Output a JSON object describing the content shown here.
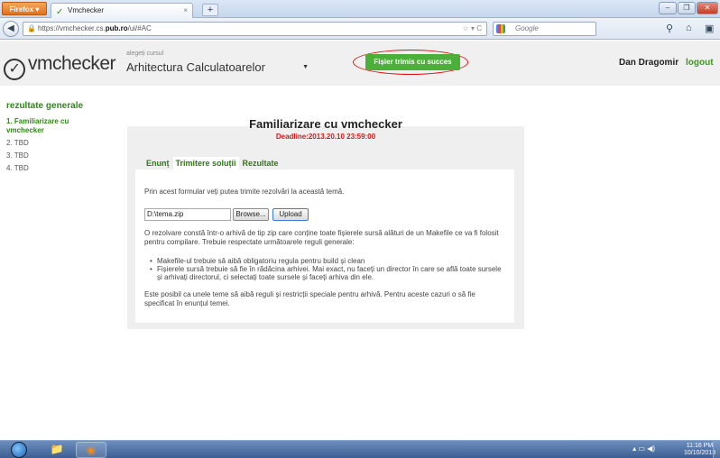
{
  "browser": {
    "menu_label": "Firefox",
    "tab_title": "Vmchecker",
    "url_prefix": "https://vmchecker.cs.",
    "url_domain": "pub.ro",
    "url_suffix": "/ui/#AC",
    "search_placeholder": "Google"
  },
  "header": {
    "logo_text": "vmchecker",
    "course_label": "alegeți cursul",
    "course_selected": "Arhitectura Calculatoarelor",
    "toast": "Fișier trimis cu succes",
    "user_name": "Dan Dragomir",
    "logout": "logout"
  },
  "sidebar": {
    "title": "rezultate generale",
    "items": [
      {
        "label": "1. Familiarizare cu vmchecker"
      },
      {
        "label": "2. TBD"
      },
      {
        "label": "3. TBD"
      },
      {
        "label": "4. TBD"
      }
    ]
  },
  "assignment": {
    "title": "Familiarizare cu vmchecker",
    "deadline": "Deadline:2013.20.10 23:59:00",
    "tabs": [
      "Enunț",
      "Trimitere soluții",
      "Rezultate"
    ],
    "intro": "Prin acest formular veți putea trimite rezolvări la această temă.",
    "file_value": "D:\\tema.zip",
    "browse_label": "Browse...",
    "upload_label": "Upload",
    "description": "O rezolvare constă într-o arhivă de tip zip care conține toate fișierele sursă alături de un Makefile ce va fi folosit pentru compilare. Trebuie respectate următoarele reguli generale:",
    "rules": [
      "Makefile-ul trebuie să aibă obligatoriu regula pentru build și clean",
      "Fișierele sursă trebuie să fie în rădăcina arhivei. Mai exact, nu faceți un director în care se află toate sursele și arhivați directorul, ci selectați toate sursele și faceți arhiva din ele."
    ],
    "note": "Este posibil ca unele teme să aibă reguli și restricții speciale pentru arhivă. Pentru aceste cazuri o să fie specificat în enunțul temei."
  },
  "taskbar": {
    "time": "11:16 PM",
    "date": "10/10/2013"
  }
}
